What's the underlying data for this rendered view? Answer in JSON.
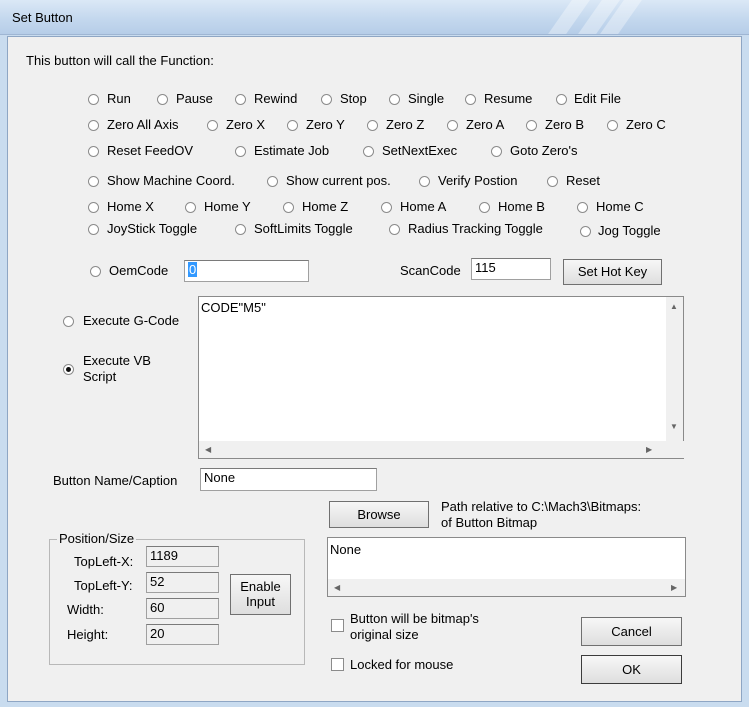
{
  "window": {
    "title": "Set Button"
  },
  "intro": "This button will call the Function:",
  "functions": {
    "run": "Run",
    "pause": "Pause",
    "rewind": "Rewind",
    "stop": "Stop",
    "single": "Single",
    "resume": "Resume",
    "edit_file": "Edit File",
    "zero_all": "Zero All Axis",
    "zero_x": "Zero X",
    "zero_y": "Zero Y",
    "zero_z": "Zero Z",
    "zero_a": "Zero A",
    "zero_b": "Zero B",
    "zero_c": "Zero C",
    "reset_feed": "Reset FeedOV",
    "estimate_job": "Estimate Job",
    "set_next_exec": "SetNextExec",
    "goto_zeros": "Goto Zero's",
    "show_machine": "Show Machine Coord.",
    "show_current": "Show current pos.",
    "verify": "Verify Postion",
    "reset": "Reset",
    "home_x": "Home X",
    "home_y": "Home Y",
    "home_z": "Home Z",
    "home_a": "Home A",
    "home_b": "Home B",
    "home_c": "Home C",
    "joystick": "JoyStick Toggle",
    "softlimits": "SoftLimits Toggle",
    "radius": "Radius Tracking Toggle",
    "jog": "Jog Toggle"
  },
  "oem": {
    "label": "OemCode",
    "value": "0"
  },
  "scan": {
    "label": "ScanCode",
    "value": "115"
  },
  "hotkey_button": "Set Hot Key",
  "exec_gcode": "Execute G-Code",
  "exec_vb": {
    "line1": "Execute VB",
    "line2": "Script",
    "selected": true
  },
  "script_text": "CODE\"M5\"",
  "caption": {
    "label": "Button Name/Caption",
    "value": "None"
  },
  "browse_button": "Browse",
  "bitmap": {
    "line1": "Path relative to C:\\Mach3\\Bitmaps:",
    "line2": "of Button Bitmap",
    "value": "None"
  },
  "position": {
    "group": "Position/Size",
    "topleft_x_label": "TopLeft-X:",
    "topleft_x": "1189",
    "topleft_y_label": "TopLeft-Y:",
    "topleft_y": "52",
    "width_label": "Width:",
    "width": "60",
    "height_label": "Height:",
    "height": "20"
  },
  "enable_input": {
    "line1": "Enable",
    "line2": "Input"
  },
  "bitmap_size": {
    "line1": "Button will be bitmap's",
    "line2": "original size"
  },
  "locked": "Locked for mouse",
  "cancel_button": "Cancel",
  "ok_button": "OK"
}
